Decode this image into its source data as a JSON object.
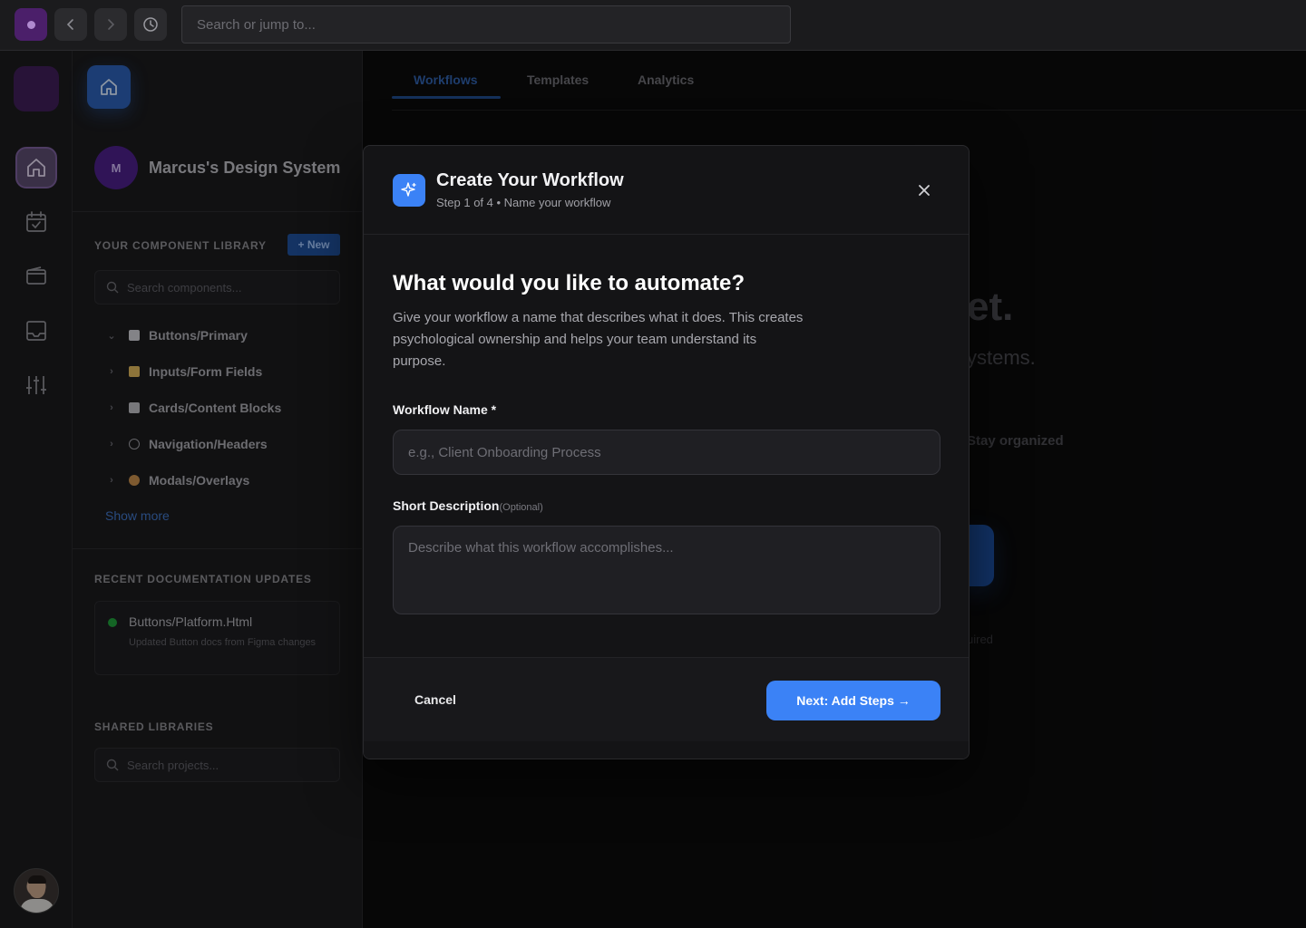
{
  "topbar": {
    "search_placeholder": "Search or jump to..."
  },
  "sidebar": {
    "workspace_initial": "M",
    "workspace_name": "Marcus's Design System",
    "library_title": "YOUR COMPONENT LIBRARY",
    "new_label": "+ New",
    "search_components_placeholder": "Search components...",
    "library_items": [
      {
        "label": "Buttons/Primary",
        "expanded": true,
        "icon": "trash-emoji",
        "color": "#c9c9cf"
      },
      {
        "label": "Inputs/Form Fields",
        "expanded": false,
        "icon": "memo-emoji",
        "color": "#d9b25a"
      },
      {
        "label": "Cards/Content Blocks",
        "expanded": false,
        "icon": "page-emoji",
        "color": "#b8b8be"
      },
      {
        "label": "Navigation/Headers",
        "expanded": false,
        "icon": "link-emoji",
        "color": "#9a9aa0"
      },
      {
        "label": "Modals/Overlays",
        "expanded": false,
        "icon": "eye-emoji",
        "color": "#c28a4a"
      }
    ],
    "show_more": "Show more",
    "recent_title": "RECENT DOCUMENTATION UPDATES",
    "recent_doc": {
      "title": "Buttons/Platform.Html",
      "subtitle": "Updated Button docs from Figma changes",
      "status_color": "#1f9c3a"
    },
    "shared_title": "SHARED LIBRARIES",
    "search_projects_placeholder": "Search projects..."
  },
  "main": {
    "tabs": [
      {
        "label": "Workflows",
        "active": true
      },
      {
        "label": "Templates",
        "active": false
      },
      {
        "label": "Analytics",
        "active": false
      }
    ],
    "bg_heading_fragment": "et.",
    "bg_sub_fragment": "ystems.",
    "bg_feature_fragment": "Stay organized",
    "bg_note_fragment": "uired"
  },
  "modal": {
    "icon": "sparkles-icon",
    "title": "Create Your Workflow",
    "step": "Step 1 of 4 • Name your workflow",
    "question": "What would you like to automate?",
    "description": "Give your workflow a name that describes what it does. This creates psychological ownership and helps your team understand its purpose.",
    "name_label": "Workflow Name *",
    "name_placeholder": "e.g., Client Onboarding Process",
    "desc_label": "Short Description",
    "desc_optional": "(Optional)",
    "desc_placeholder": "Describe what this workflow accomplishes...",
    "cancel_label": "Cancel",
    "next_label": "Next: Add Steps →",
    "accent": "#3b82f6"
  }
}
